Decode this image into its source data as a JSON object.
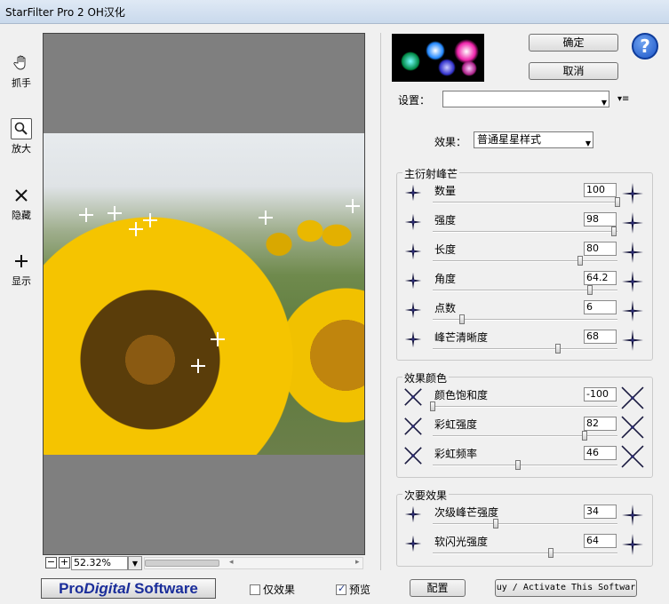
{
  "window": {
    "title": "StarFilter Pro 2 OH汉化"
  },
  "tools": [
    {
      "label": "抓手",
      "icon": "hand-icon"
    },
    {
      "label": "放大",
      "icon": "magnifier-icon"
    },
    {
      "label": "隐藏",
      "icon": "x-icon"
    },
    {
      "label": "显示",
      "icon": "plus-icon"
    }
  ],
  "zoom": {
    "value": "52.32%"
  },
  "buttons": {
    "ok": "确定",
    "cancel": "取消",
    "help": "?",
    "config": "配置",
    "buy": "uy / Activate This Softwar"
  },
  "settings": {
    "label": "设置：",
    "value": ""
  },
  "effect": {
    "label": "效果：",
    "value": "普通星星样式"
  },
  "groups": {
    "main": {
      "title": "主衍射峰芒",
      "sliders": [
        {
          "label": "数量",
          "value": "100",
          "level": 1.0
        },
        {
          "label": "强度",
          "value": "98",
          "level": 0.98
        },
        {
          "label": "长度",
          "value": "80",
          "level": 0.8
        },
        {
          "label": "角度",
          "value": "64.2",
          "level": 0.85
        },
        {
          "label": "点数",
          "value": "6",
          "level": 0.16
        },
        {
          "label": "峰芒清晰度",
          "value": "68",
          "level": 0.68
        }
      ]
    },
    "color": {
      "title": "效果颜色",
      "sliders": [
        {
          "label": "颜色饱和度",
          "value": "-100",
          "level": 0.0
        },
        {
          "label": "彩虹强度",
          "value": "82",
          "level": 0.82
        },
        {
          "label": "彩虹频率",
          "value": "46",
          "level": 0.46
        }
      ]
    },
    "secondary": {
      "title": "次要效果",
      "sliders": [
        {
          "label": "次级峰芒强度",
          "value": "34",
          "level": 0.34
        },
        {
          "label": "软闪光强度",
          "value": "64",
          "level": 0.64
        }
      ]
    }
  },
  "bottom": {
    "logo_pro": "Pro",
    "logo_digital": "Digital",
    "logo_software": " Software",
    "only_effect": "仅效果",
    "only_effect_checked": false,
    "preview": "预览",
    "preview_checked": true
  },
  "colors": {
    "accent": "#1a2d9a",
    "help": "#1b55c8"
  }
}
